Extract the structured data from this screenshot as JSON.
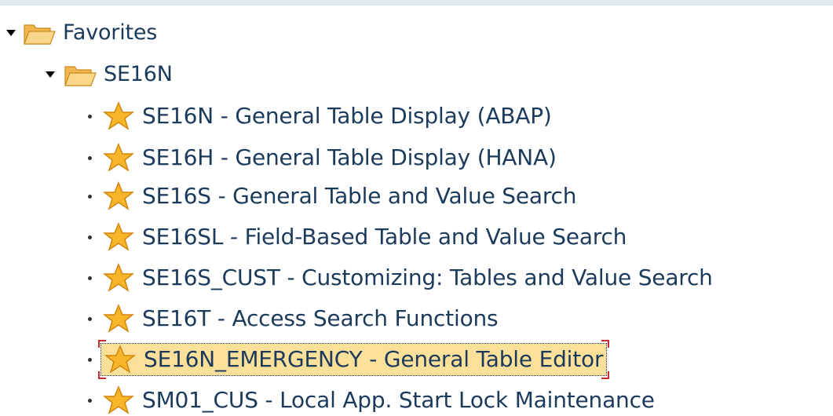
{
  "tree": {
    "root": {
      "label": "Favorites",
      "icon": "folder-icon",
      "expanded": true
    },
    "folder": {
      "label": "SE16N",
      "icon": "folder-icon",
      "expanded": true
    },
    "items": [
      {
        "label": "SE16N - General Table Display (ABAP)",
        "icon": "star-icon",
        "selected": false
      },
      {
        "label": "SE16H - General Table Display (HANA)",
        "icon": "star-icon",
        "selected": false
      },
      {
        "label": "SE16S - General Table and Value Search",
        "icon": "star-icon",
        "selected": false
      },
      {
        "label": "SE16SL - Field-Based Table and Value Search",
        "icon": "star-icon",
        "selected": false
      },
      {
        "label": "SE16S_CUST - Customizing: Tables and Value Search",
        "icon": "star-icon",
        "selected": false
      },
      {
        "label": "SE16T - Access Search Functions",
        "icon": "star-icon",
        "selected": false
      },
      {
        "label": "SE16N_EMERGENCY - General Table Editor",
        "icon": "star-icon",
        "selected": true
      },
      {
        "label": "SM01_CUS - Local App. Start Lock Maintenance",
        "icon": "star-icon",
        "selected": false
      }
    ]
  },
  "colors": {
    "text": "#1c3a5b",
    "selection_background": "#fbe09a",
    "selection_corner": "#d0282b",
    "folder_fill": "#f6c56a",
    "star_fill": "#f7b52a",
    "top_border": "#dfe8f3"
  }
}
